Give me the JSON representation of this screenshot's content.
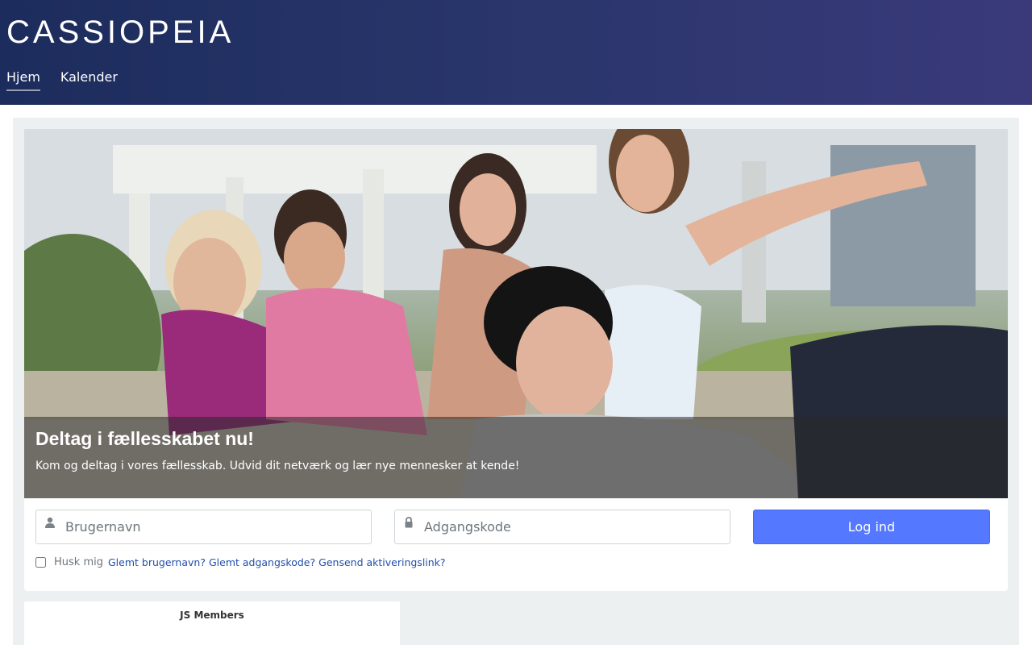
{
  "header": {
    "logo_text": "CASSIOPEIA",
    "nav": [
      {
        "label": "Hjem",
        "active": true
      },
      {
        "label": "Kalender",
        "active": false
      }
    ]
  },
  "hero": {
    "title": "Deltag i fællesskabet nu!",
    "text": "Kom og deltag i vores fællesskab. Udvid dit netværk og lær nye mennesker at kende!"
  },
  "login": {
    "username_placeholder": "Brugernavn",
    "password_placeholder": "Adgangskode",
    "username_icon": "user-icon",
    "password_icon": "lock-icon",
    "submit_label": "Log ind",
    "remember_label": "Husk mig",
    "remember_checked": false,
    "links": [
      "Glemt brugernavn?",
      "Glemt adgangskode?",
      "Gensend aktiveringslink?"
    ]
  },
  "members_module": {
    "title": "JS Members"
  },
  "colors": {
    "header_gradient_start": "#1c2c5c",
    "header_gradient_end": "#3a3a7a",
    "button": "#5478ff",
    "link": "#224faa",
    "page_bg": "#edf0f1"
  }
}
